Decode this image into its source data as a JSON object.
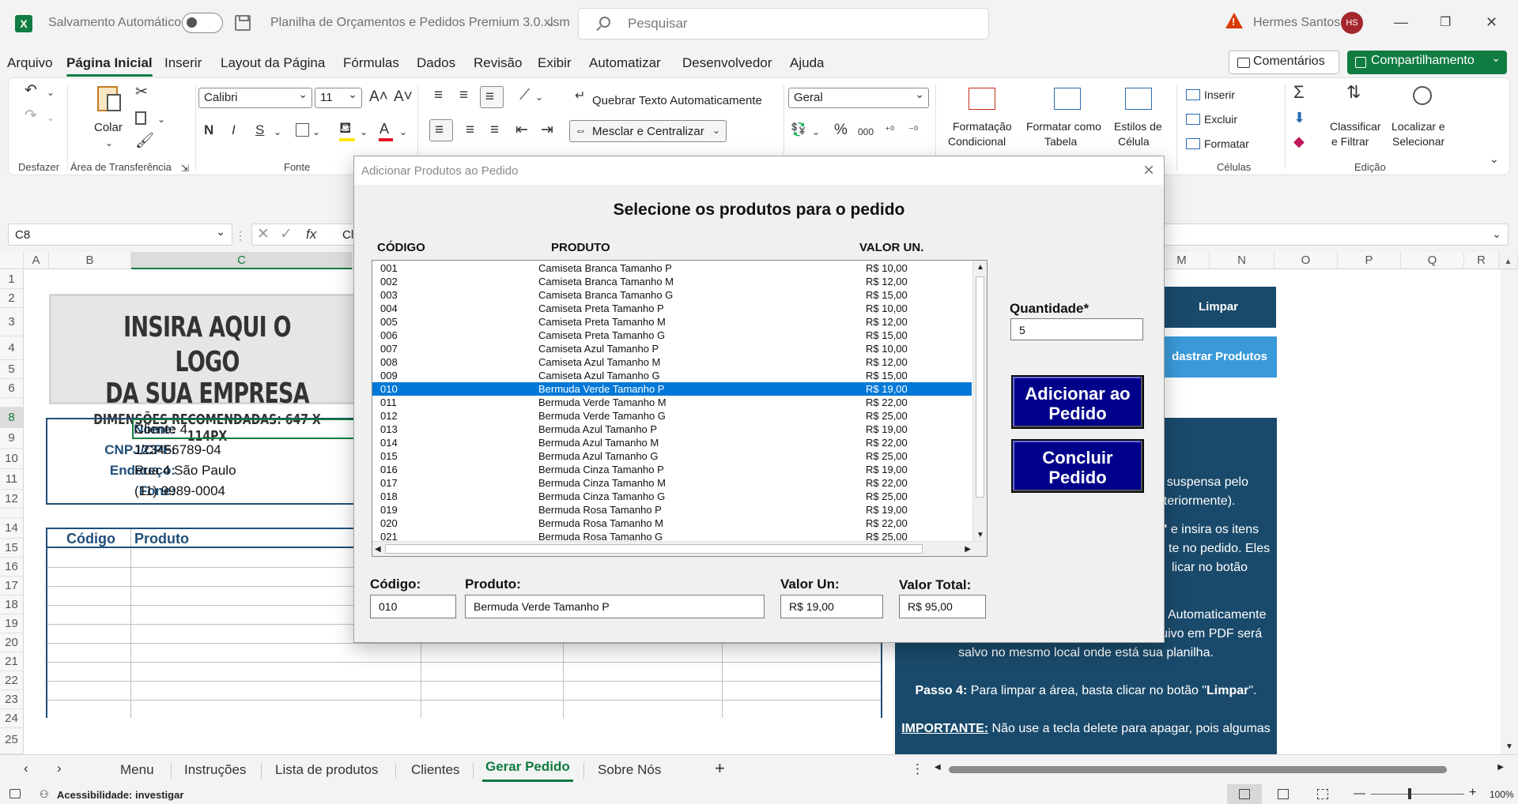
{
  "titlebar": {
    "autosave_label": "Salvamento Automático",
    "filename": "Planilha de Orçamentos e Pedidos Premium 3.0.xlsm",
    "search_placeholder": "Pesquisar",
    "user_name": "Hermes Santos",
    "user_initials": "HS"
  },
  "menu": {
    "tabs": [
      "Arquivo",
      "Página Inicial",
      "Inserir",
      "Layout da Página",
      "Fórmulas",
      "Dados",
      "Revisão",
      "Exibir",
      "Automatizar",
      "Desenvolvedor",
      "Ajuda"
    ],
    "active_tab": "Página Inicial",
    "comments_label": "Comentários",
    "share_label": "Compartilhamento"
  },
  "ribbon": {
    "groups": {
      "undo": "Desfazer",
      "clipboard": "Área de Transferência",
      "font": "Fonte",
      "cells": "Células",
      "editing": "Edição"
    },
    "paste_label": "Colar",
    "font_name": "Calibri",
    "font_size": "11",
    "wrap_text": "Quebrar Texto Automaticamente",
    "merge_center": "Mesclar e Centralizar",
    "number_format": "Geral",
    "cond_format_1": "Formatação",
    "cond_format_2": "Condicional",
    "format_table_1": "Formatar como",
    "format_table_2": "Tabela",
    "cell_styles_1": "Estilos de",
    "cell_styles_2": "Célula",
    "insert": "Inserir",
    "delete": "Excluir",
    "format": "Formatar",
    "sort_1": "Classificar",
    "sort_2": "e Filtrar",
    "find_1": "Localizar e",
    "find_2": "Selecionar",
    "bold": "N",
    "italic": "I",
    "underline": "S",
    "percent": "%",
    "thousands": "000"
  },
  "formula_bar": {
    "name_box": "C8",
    "fx": "fx",
    "content": "Cl"
  },
  "sheet": {
    "columns_left": [
      "A",
      "B",
      "C"
    ],
    "columns_right": [
      "M",
      "N",
      "O",
      "P",
      "Q",
      "R"
    ],
    "rows": [
      "1",
      "2",
      "3",
      "4",
      "5",
      "6",
      "8",
      "9",
      "10",
      "11",
      "12",
      "14",
      "15",
      "16",
      "17",
      "18",
      "19",
      "20",
      "21",
      "22",
      "23",
      "24",
      "25"
    ],
    "logo_line1": "INSIRA AQUI O LOGO",
    "logo_line2": "DA SUA EMPRESA",
    "logo_line3": "DIMENSÕES RECOMENDADAS: 647 X 114PX",
    "client": [
      {
        "label": "Nome:",
        "value": "Cliente 4"
      },
      {
        "label": "CNPJ/CPF:",
        "value": "123456789-04"
      },
      {
        "label": "Endereço:",
        "value": "Rua 4 São Paulo"
      },
      {
        "label": "Fone:",
        "value": "(11) 9989-0004"
      }
    ],
    "order_col_code": "Código",
    "order_col_product": "Produto",
    "btn_clear": "Limpar",
    "btn_register_products": "dastrar Produtos",
    "instructions": {
      "l1": "sta suspensa pelo",
      "l2": "anteriormente).",
      "l3a": "s\"",
      "l3b": " e insira os itens",
      "l4": "te no pedido. Eles",
      "l5": "licar no botão",
      "l6": "Automaticamente",
      "l7": "será criado um número para o Pedido. O arquivo em PDF será",
      "l8": "salvo no mesmo local onde está sua planilha.",
      "step4_bold": "Passo 4:",
      "step4_text": " Para limpar a área, basta clicar no botão \"",
      "step4_btn": "Limpar",
      "step4_end": "\".",
      "important_bold": "IMPORTANTE:",
      "important_text": " Não use a tecla delete para apagar, pois algumas"
    }
  },
  "sheet_tabs": [
    "Menu",
    "Instruções",
    "Lista de produtos",
    "Clientes",
    "Gerar Pedido",
    "Sobre Nós"
  ],
  "active_sheet": "Gerar Pedido",
  "status": {
    "accessibility": "Acessibilidade: investigar",
    "zoom": "100%"
  },
  "dialog": {
    "title": "Adicionar Produtos ao Pedido",
    "heading": "Selecione os produtos para o pedido",
    "col_code": "CÓDIGO",
    "col_product": "PRODUTO",
    "col_price": "VALOR UN.",
    "selected_index": 9,
    "products": [
      {
        "code": "001",
        "name": "Camiseta Branca Tamanho P",
        "price": "R$ 10,00"
      },
      {
        "code": "002",
        "name": "Camiseta Branca Tamanho M",
        "price": "R$ 12,00"
      },
      {
        "code": "003",
        "name": "Camiseta Branca Tamanho G",
        "price": "R$ 15,00"
      },
      {
        "code": "004",
        "name": "Camiseta Preta Tamanho P",
        "price": "R$ 10,00"
      },
      {
        "code": "005",
        "name": "Camiseta Preta Tamanho M",
        "price": "R$ 12,00"
      },
      {
        "code": "006",
        "name": "Camiseta Preta Tamanho G",
        "price": "R$ 15,00"
      },
      {
        "code": "007",
        "name": "Camiseta Azul Tamanho P",
        "price": "R$ 10,00"
      },
      {
        "code": "008",
        "name": "Camiseta Azul Tamanho M",
        "price": "R$ 12,00"
      },
      {
        "code": "009",
        "name": "Camiseta Azul Tamanho G",
        "price": "R$ 15,00"
      },
      {
        "code": "010",
        "name": "Bermuda Verde Tamanho P",
        "price": "R$ 19,00"
      },
      {
        "code": "011",
        "name": "Bermuda Verde Tamanho M",
        "price": "R$ 22,00"
      },
      {
        "code": "012",
        "name": "Bermuda Verde Tamanho G",
        "price": "R$ 25,00"
      },
      {
        "code": "013",
        "name": "Bermuda Azul Tamanho P",
        "price": "R$ 19,00"
      },
      {
        "code": "014",
        "name": "Bermuda Azul Tamanho M",
        "price": "R$ 22,00"
      },
      {
        "code": "015",
        "name": "Bermuda Azul Tamanho G",
        "price": "R$ 25,00"
      },
      {
        "code": "016",
        "name": "Bermuda Cinza Tamanho P",
        "price": "R$ 19,00"
      },
      {
        "code": "017",
        "name": "Bermuda Cinza Tamanho M",
        "price": "R$ 22,00"
      },
      {
        "code": "018",
        "name": "Bermuda Cinza Tamanho G",
        "price": "R$ 25,00"
      },
      {
        "code": "019",
        "name": "Bermuda Rosa Tamanho P",
        "price": "R$ 19,00"
      },
      {
        "code": "020",
        "name": "Bermuda Rosa Tamanho M",
        "price": "R$ 22,00"
      },
      {
        "code": "021",
        "name": "Bermuda Rosa Tamanho G",
        "price": "R$ 25,00"
      }
    ],
    "qty_label": "Quantidade*",
    "qty_value": "5",
    "btn_add": "Adicionar ao Pedido",
    "btn_finish": "Concluir Pedido",
    "code_label": "Código:",
    "code_value": "010",
    "product_label": "Produto:",
    "product_value": "Bermuda Verde Tamanho P",
    "unit_label": "Valor Un:",
    "unit_value": "R$ 19,00",
    "total_label": "Valor Total:",
    "total_value": "R$ 95,00"
  },
  "colors": {
    "excel_green": "#107c41",
    "navy_header": "#1f4e79",
    "dialog_button": "#00008b",
    "selection": "#0078d7",
    "instructions_panel": "#1a4a6b",
    "cadastrar_btn": "#3a9ad9"
  }
}
